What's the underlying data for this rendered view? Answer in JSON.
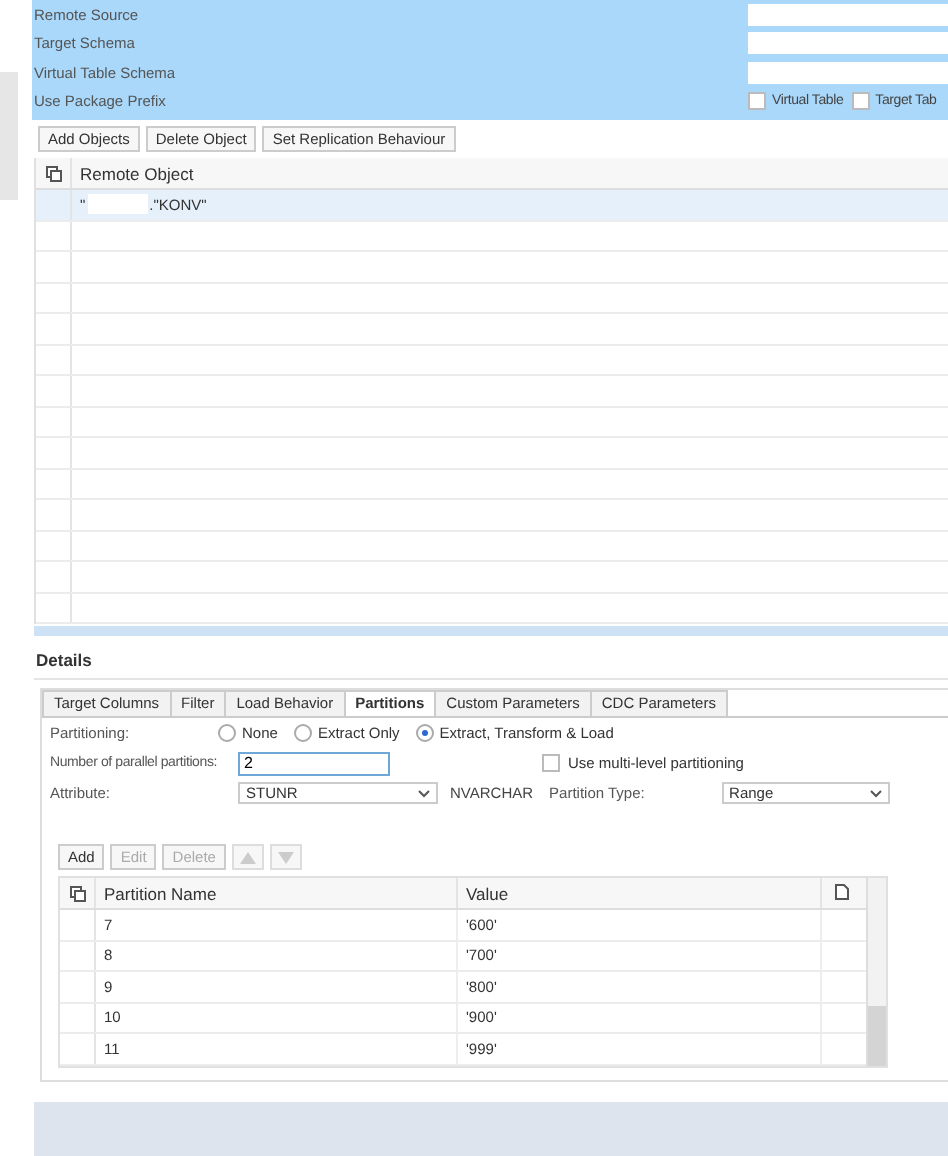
{
  "header": {
    "fields": [
      {
        "label": "Remote Source"
      },
      {
        "label": "Target Schema"
      },
      {
        "label": "Virtual Table Schema"
      }
    ],
    "package_prefix": {
      "label": "Use Package Prefix",
      "options": [
        {
          "label": "Virtual Table",
          "checked": false
        },
        {
          "label": "Target Tab",
          "checked": false
        }
      ]
    }
  },
  "toolbar": [
    "Add Objects",
    "Delete Object",
    "Set Replication Behaviour"
  ],
  "remote_table": {
    "column": "Remote Object",
    "rows": [
      {
        "prefix": "\"",
        "suffix": ".\"KONV\"",
        "selected": true
      }
    ]
  },
  "details": {
    "title": "Details",
    "tabs": [
      {
        "label": "Target Columns",
        "selected": false
      },
      {
        "label": "Filter",
        "selected": false
      },
      {
        "label": "Load Behavior",
        "selected": false
      },
      {
        "label": "Partitions",
        "selected": true
      },
      {
        "label": "Custom Parameters",
        "selected": false
      },
      {
        "label": "CDC Parameters",
        "selected": false
      }
    ],
    "partitioning": {
      "label": "Partitioning:",
      "options": [
        {
          "label": "None",
          "selected": false
        },
        {
          "label": "Extract Only",
          "selected": false
        },
        {
          "label": "Extract, Transform & Load",
          "selected": true
        }
      ]
    },
    "parallel": {
      "label": "Number of parallel partitions:",
      "value": "2"
    },
    "multi_level": {
      "label": "Use multi-level partitioning",
      "checked": false
    },
    "attribute": {
      "label": "Attribute:",
      "value": "STUNR",
      "type": "NVARCHAR"
    },
    "partition_type": {
      "label": "Partition Type:",
      "value": "Range"
    },
    "buttons": [
      {
        "label": "Add",
        "disabled": false
      },
      {
        "label": "Edit",
        "disabled": true
      },
      {
        "label": "Delete",
        "disabled": true
      }
    ],
    "table": {
      "columns": [
        "Partition Name",
        "Value"
      ],
      "rows": [
        [
          "7",
          "'600'"
        ],
        [
          "8",
          "'700'"
        ],
        [
          "9",
          "'800'"
        ],
        [
          "10",
          "'900'"
        ],
        [
          "11",
          "'999'"
        ]
      ]
    }
  }
}
